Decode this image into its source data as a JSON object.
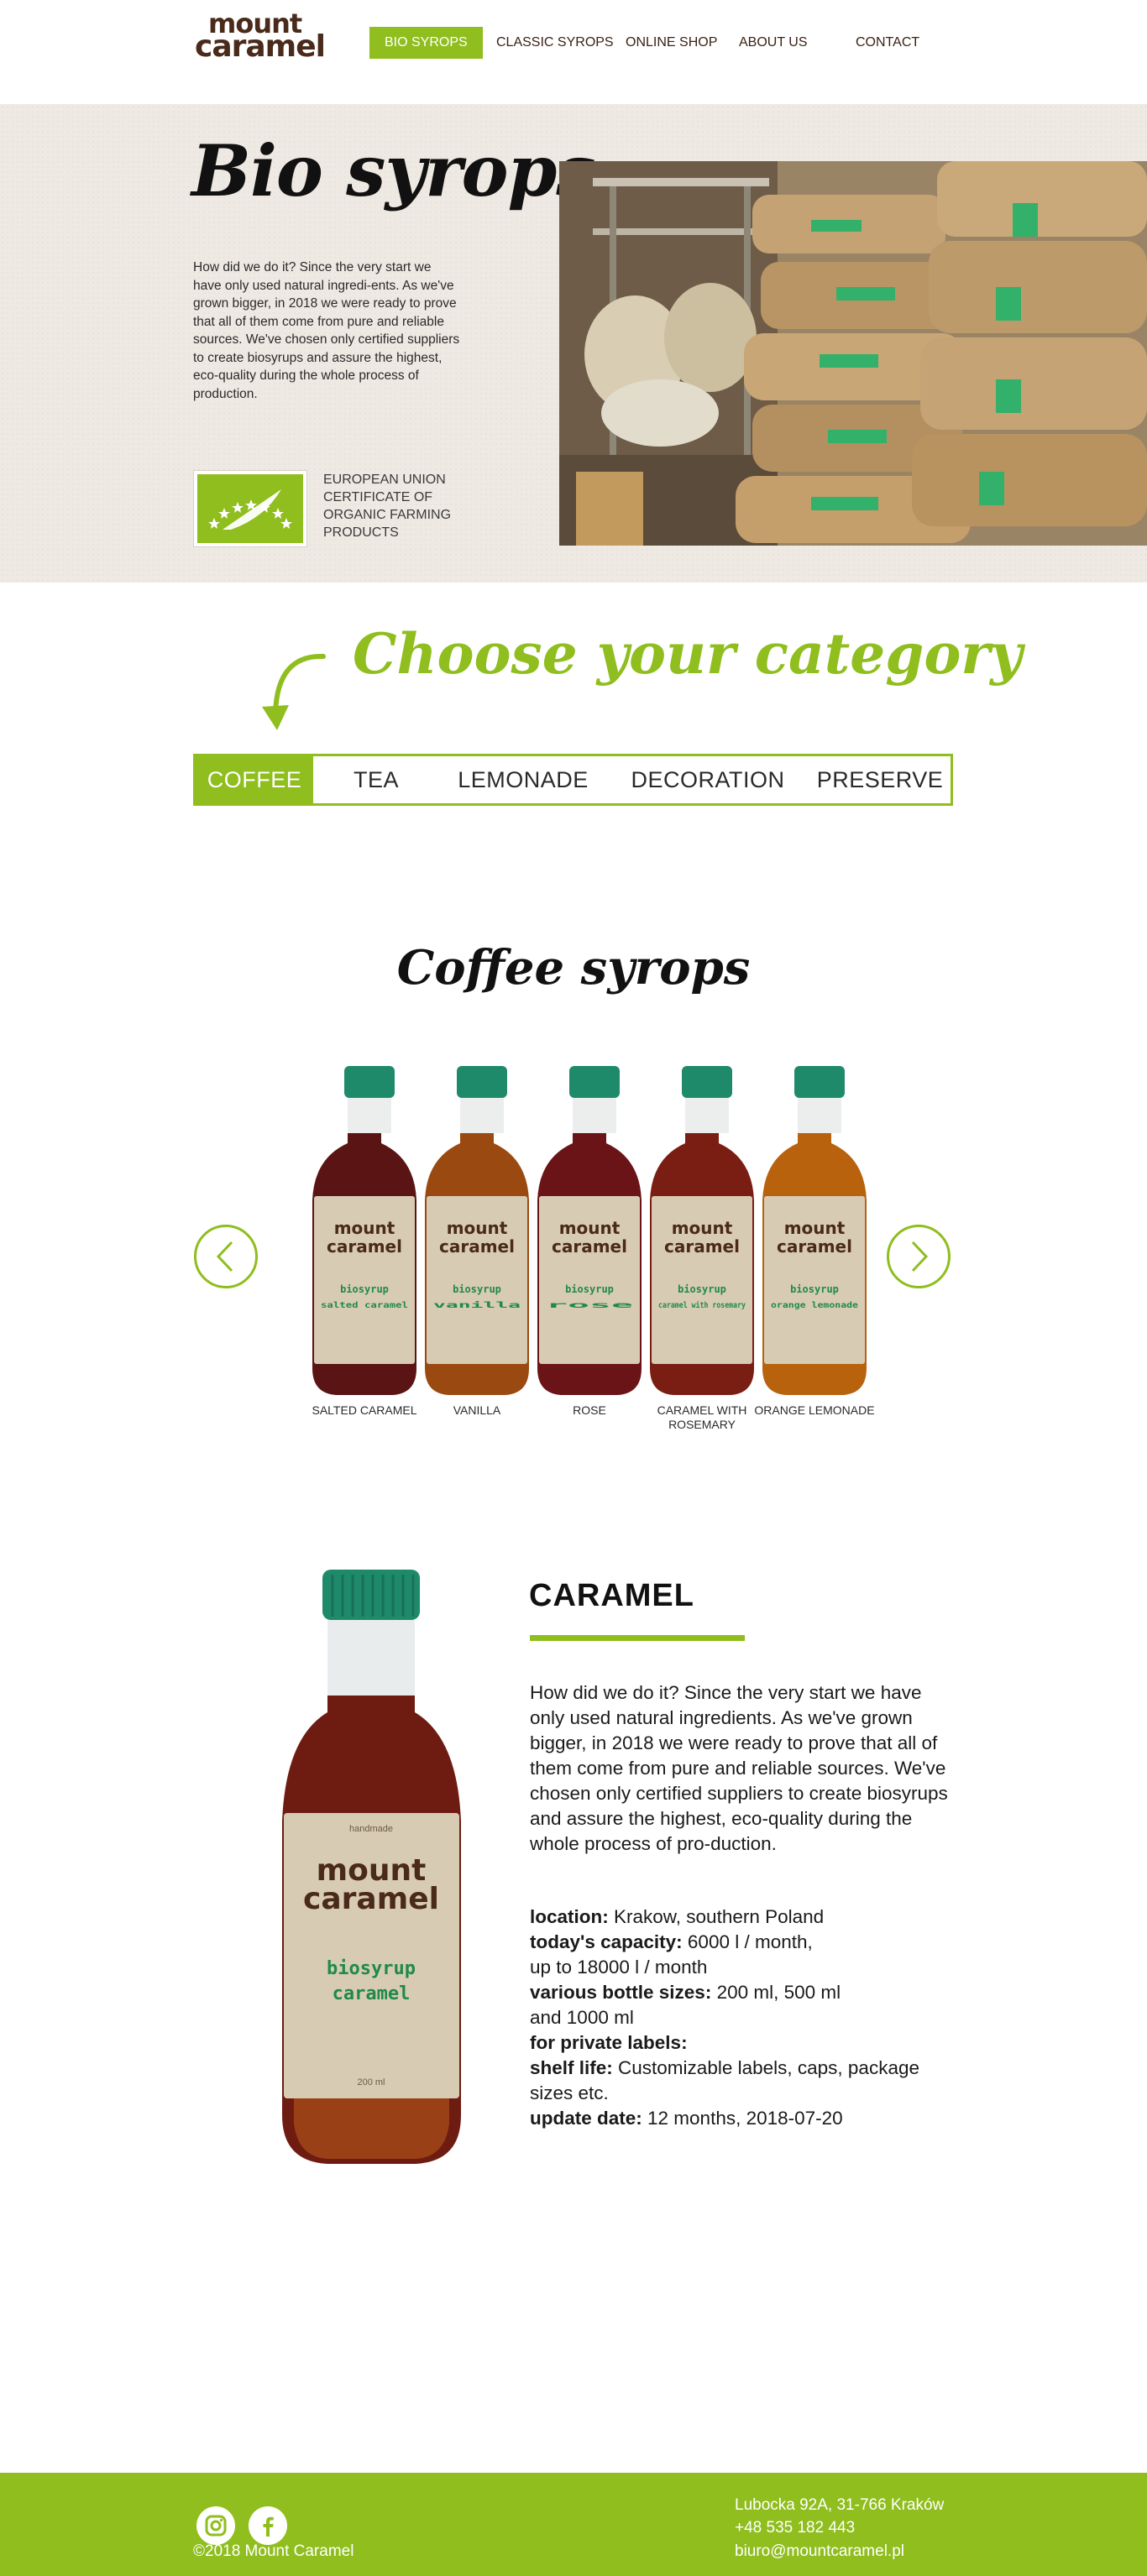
{
  "brand": {
    "line1": "mount",
    "line2": "caramel"
  },
  "nav": {
    "bio": "BIO SYROPS",
    "classic": "CLASSIC SYROPS",
    "shop": "ONLINE SHOP",
    "about": "ABOUT US",
    "contact": "CONTACT"
  },
  "hero": {
    "title": "Bio syrops",
    "text": "How did we do it? Since the very start we have only used natural ingredi-ents. As we've grown bigger, in 2018 we were ready to prove that all of them come from pure and reliable sources. We've chosen only certified suppliers to create biosyrups and assure the highest, eco-quality during the whole process of production.",
    "certificate": "EUROPEAN UNION CERTIFICATE OF ORGANIC FARMING PRODUCTS"
  },
  "category": {
    "title": "Choose your category",
    "tabs": [
      "COFFEE",
      "TEA",
      "LEMONADE",
      "DECORATION",
      "PRESERVE"
    ]
  },
  "coffee": {
    "title": "Coffee syrops",
    "bottles": [
      {
        "name": "SALTED CARAMEL",
        "label_top": "mount",
        "label_brand": "caramel",
        "label_kind": "biosyrup",
        "label_flavor": "salted caramel",
        "liquid": "#5a1414"
      },
      {
        "name": "VANILLA",
        "label_top": "mount",
        "label_brand": "caramel",
        "label_kind": "biosyrup",
        "label_flavor": "vanilla",
        "liquid": "#9a4a10"
      },
      {
        "name": "ROSE",
        "label_top": "mount",
        "label_brand": "caramel",
        "label_kind": "biosyrup",
        "label_flavor": "rose",
        "liquid": "#6a1418"
      },
      {
        "name": "CARAMEL WITH ROSEMARY",
        "label_top": "mount",
        "label_brand": "caramel",
        "label_kind": "biosyrup",
        "label_flavor": "caramel with rosemary",
        "liquid": "#7a1e14"
      },
      {
        "name": "ORANGE LEMONADE",
        "label_top": "mount",
        "label_brand": "caramel",
        "label_kind": "biosyrup",
        "label_flavor": "orange lemonade",
        "liquid": "#b8620e"
      }
    ]
  },
  "detail": {
    "title": "CARAMEL",
    "text": "How did we do it? Since the very start we have only used natural ingredients. As we've grown bigger, in 2018 we were ready to prove that all of them come from pure and reliable sources. We've chosen only certified suppliers to create biosyrups and assure the highest, eco-quality during the whole process of pro-duction.",
    "bottle": {
      "handmade": "handmade",
      "brand1": "mount",
      "brand2": "caramel",
      "kind": "biosyrup",
      "flavor": "caramel",
      "volume": "200 ml"
    },
    "location_label": "location:",
    "location_value": " Krakow, southern Poland",
    "capacity_label": "today's capacity:",
    "capacity_value": " 6000 l / month,",
    "capacity_value2": "up to 18000 l / month",
    "sizes_label": "various bottle sizes:",
    "sizes_value": " 200 ml, 500 ml",
    "sizes_value2": "and 1000 ml",
    "private_label": "for private labels:",
    "shelf_label": "shelf life:",
    "shelf_value": " Customizable labels, caps, package",
    "shelf_value2": "sizes etc.",
    "update_label": "update date:",
    "update_value": "  12 months, 2018-07-20"
  },
  "footer": {
    "copyright": "©2018 Mount Caramel",
    "address": "Lubocka 92A, 31-766 Kraków",
    "phone": "+48 535 182 443",
    "email": "biuro@mountcaramel.pl"
  },
  "colors": {
    "accent": "#8fbe1e",
    "brand_brown": "#4a2a1a",
    "cap_green": "#1f8a6a"
  }
}
